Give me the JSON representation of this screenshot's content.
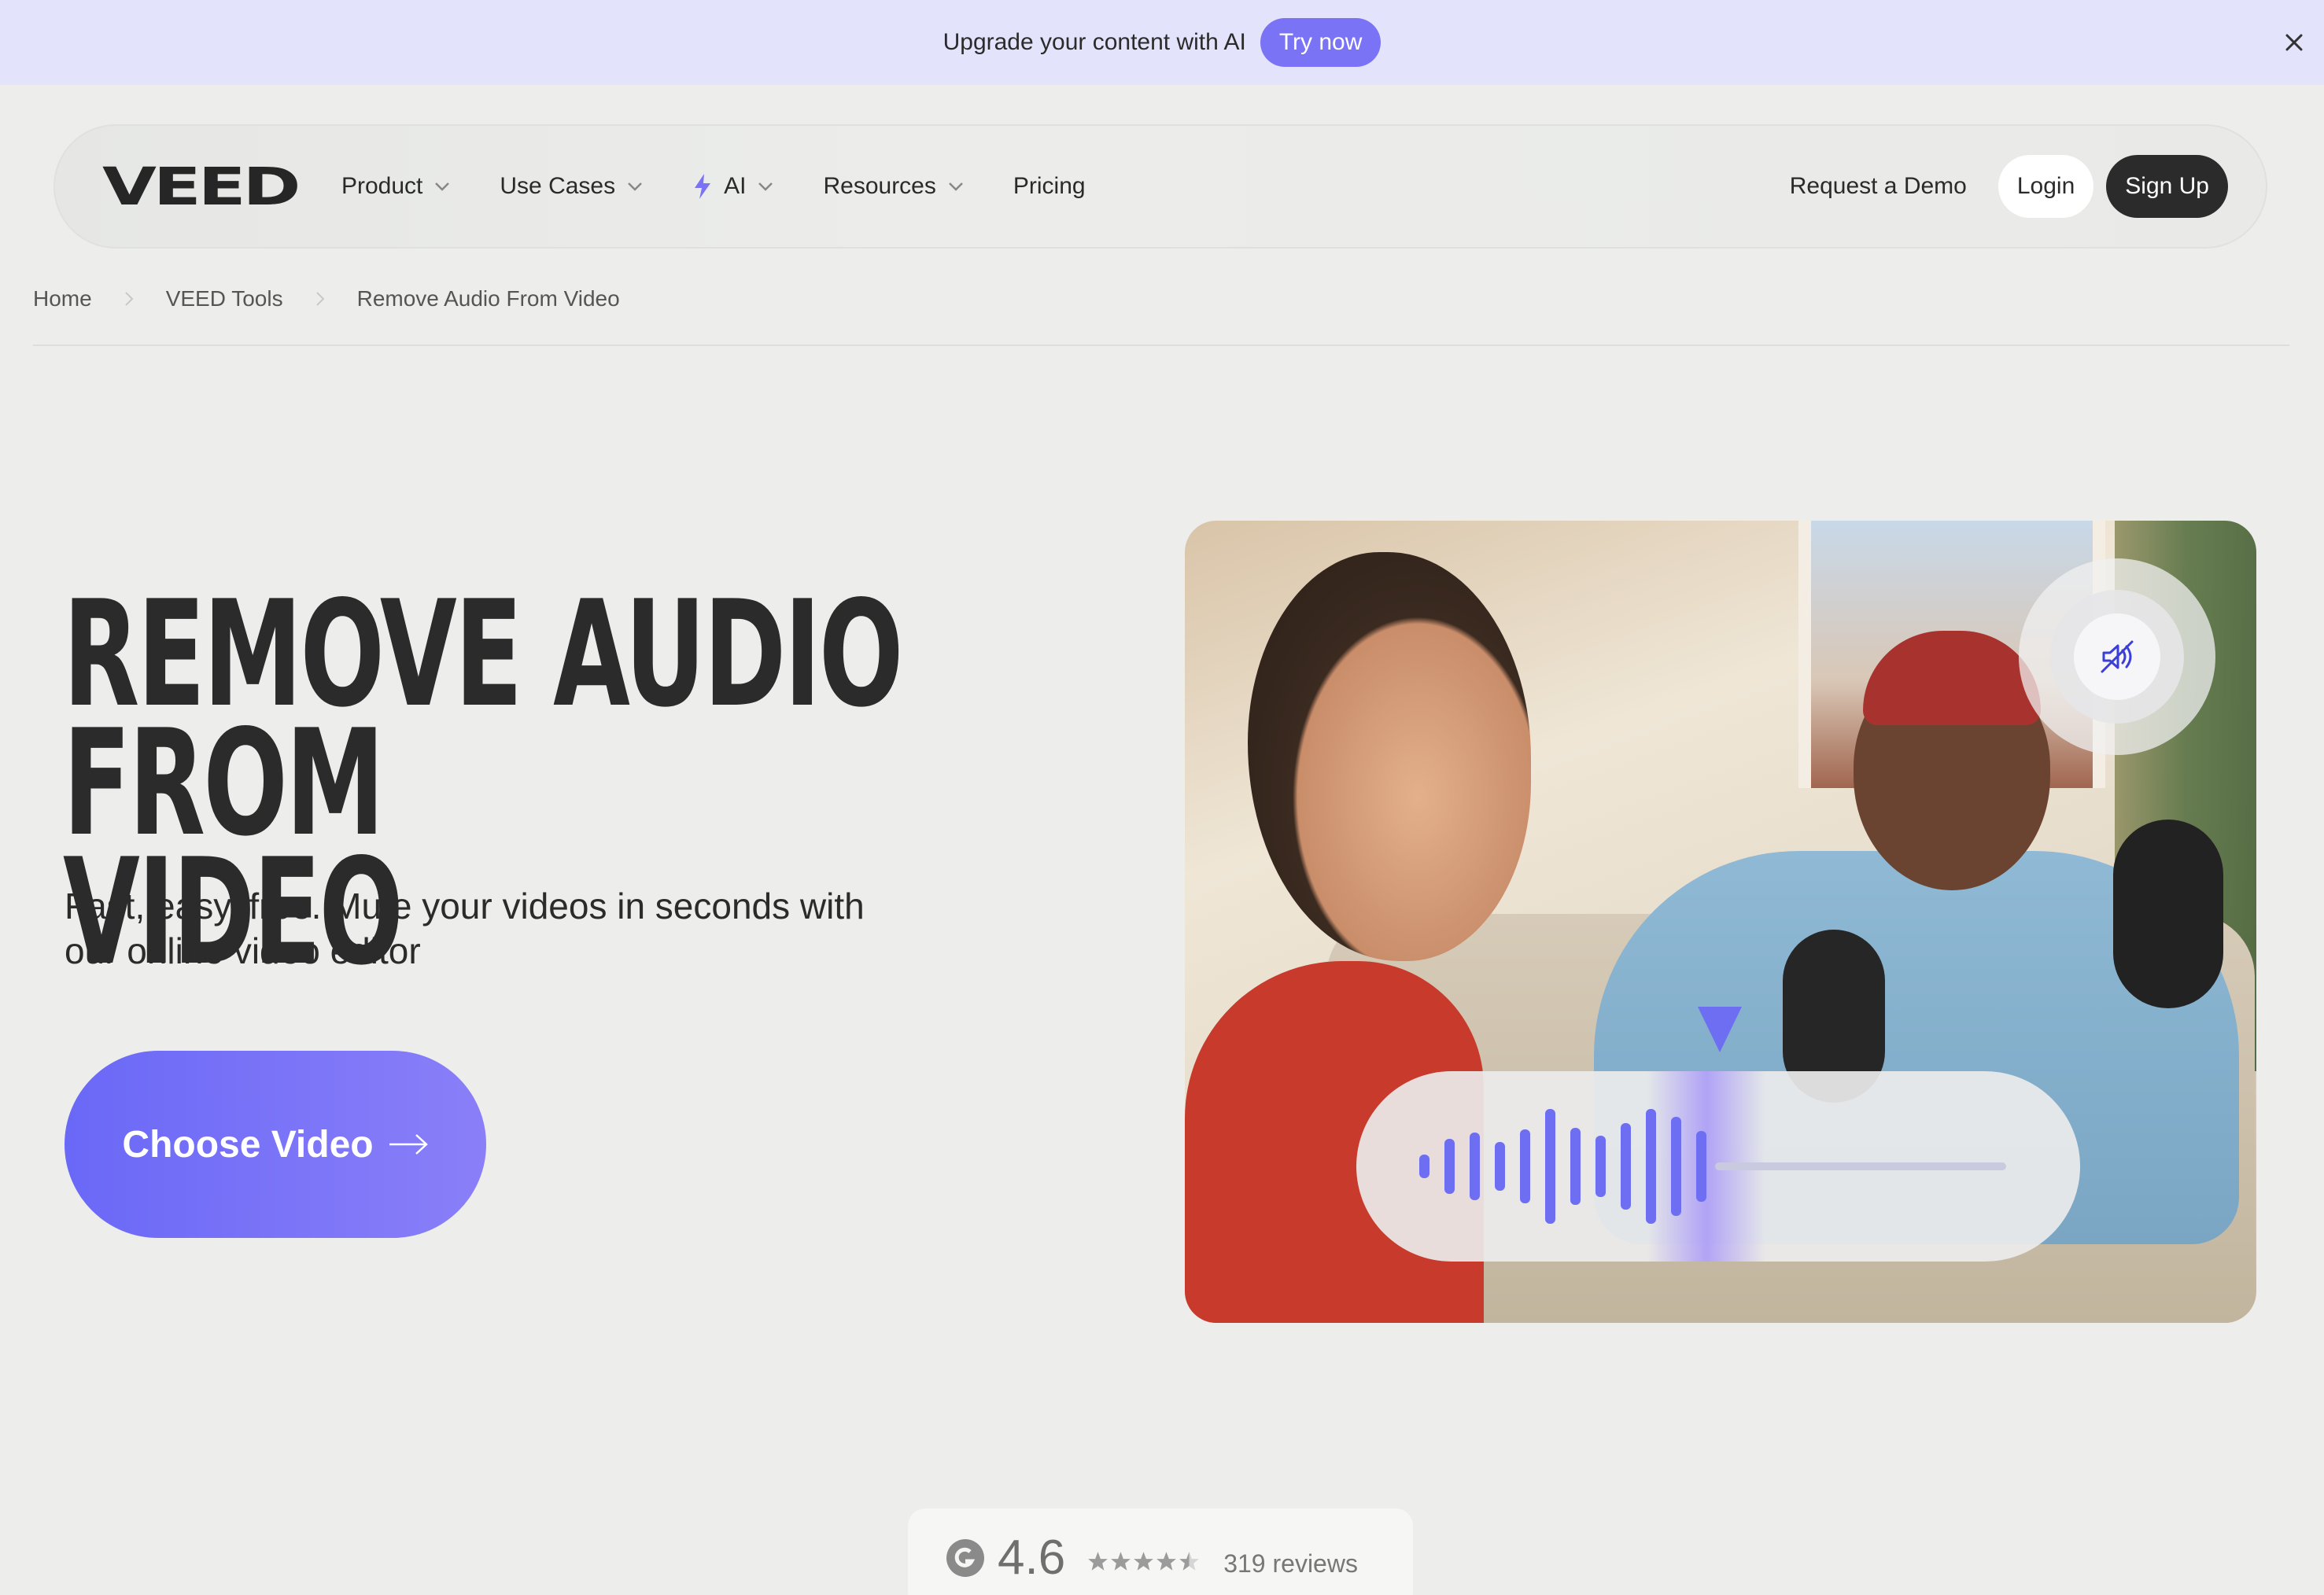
{
  "promo": {
    "text": "Upgrade your content with AI",
    "cta_label": "Try now",
    "close_icon": "close-icon"
  },
  "nav": {
    "logo": "VEED",
    "items": [
      {
        "label": "Product",
        "has_dropdown": true
      },
      {
        "label": "Use Cases",
        "has_dropdown": true
      },
      {
        "label": "AI",
        "has_dropdown": true,
        "icon": "lightning-icon"
      },
      {
        "label": "Resources",
        "has_dropdown": true
      },
      {
        "label": "Pricing",
        "has_dropdown": false
      }
    ],
    "request_demo": "Request a Demo",
    "login": "Login",
    "signup": "Sign Up"
  },
  "breadcrumb": [
    "Home",
    "VEED Tools",
    "Remove Audio From Video"
  ],
  "hero": {
    "title_line1": "REMOVE AUDIO FROM",
    "title_line2": "VIDEO",
    "subtitle_line1": "Fast, easy, free. Mute your videos in seconds with",
    "subtitle_line2": "our online video editor",
    "cta_label": "Choose Video",
    "image_icon": "mute-audio-icon"
  },
  "rating": {
    "badge": "G2",
    "score": "4.6",
    "stars_filled": 4.5,
    "stars_total": 5,
    "reviews": "319 reviews"
  },
  "colors": {
    "accent": "#7a73f5",
    "banner_bg": "#e3e3fb",
    "page_bg": "#edeeec",
    "dark": "#2b2b2b"
  }
}
